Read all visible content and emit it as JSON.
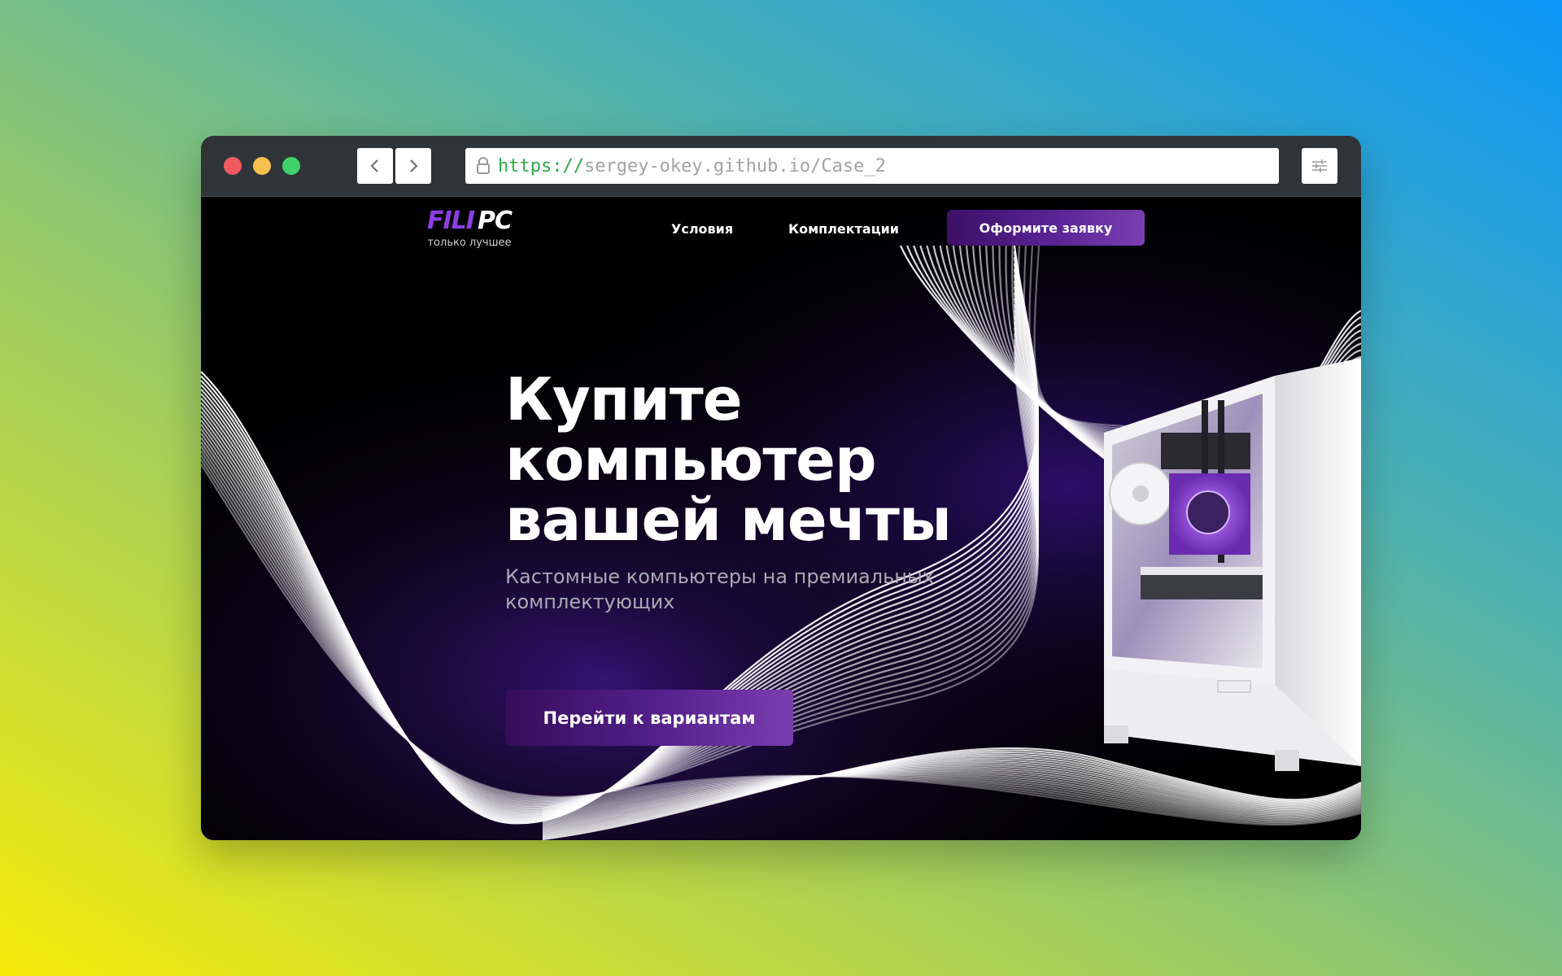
{
  "browser": {
    "url_scheme": "https://",
    "url_host": "sergey-okey.github.io/Case_2",
    "window_controls": [
      "close",
      "minimize",
      "maximize"
    ],
    "icons": {
      "back": "chevron-left-icon",
      "forward": "chevron-right-icon",
      "lock": "lock-icon",
      "settings": "sliders-icon"
    }
  },
  "site": {
    "logo_primary": "FILI",
    "logo_secondary": "PC",
    "tagline": "только лучшее",
    "nav": {
      "conditions": "Условия",
      "configurations": "Комплектации"
    },
    "header_cta": "Оформите заявку",
    "hero": {
      "title": "Купите компьютер вашей мечты",
      "subtitle": "Кастомные компьютеры на премиальных комплектующих",
      "cta": "Перейти к вариантам"
    },
    "colors": {
      "accent": "#8b3fe0",
      "button_gradient_start": "#3d0f66",
      "button_gradient_end": "#7a3fb0",
      "background": "#000000"
    }
  }
}
